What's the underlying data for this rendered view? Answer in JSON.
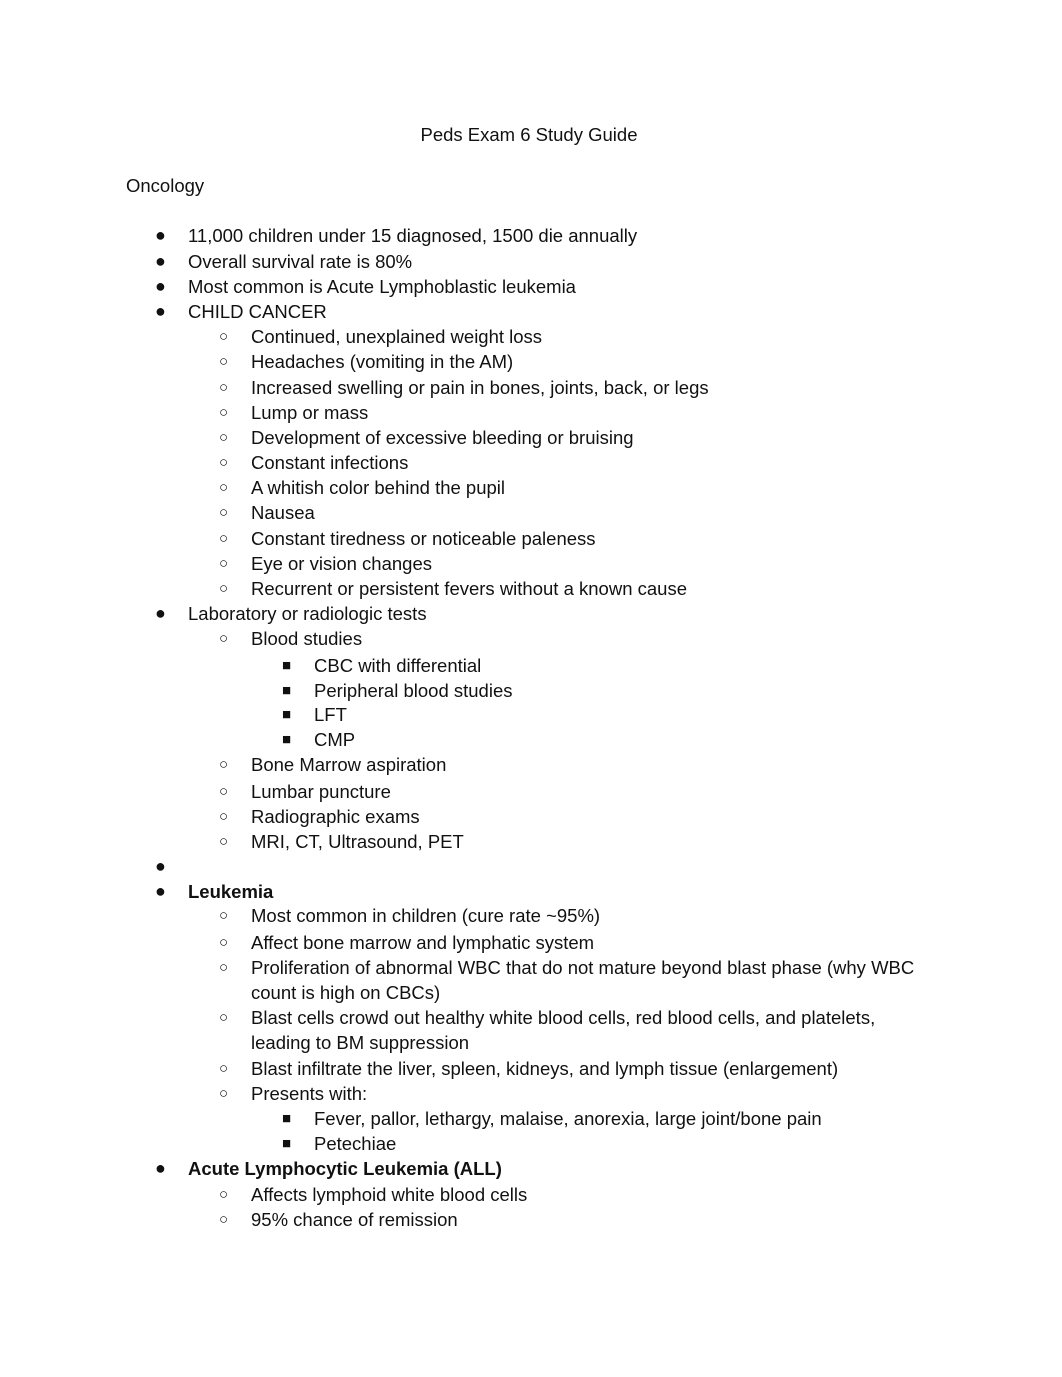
{
  "document": {
    "title": "Peds Exam 6 Study Guide",
    "section_heading": "Oncology",
    "bullet_glyphs": {
      "level1": "●",
      "level2": "○",
      "level3": "■"
    },
    "items": {
      "stats1": "11,000 children under 15 diagnosed, 1500 die annually",
      "stats2": "Overall survival rate is 80%",
      "stats3": "Most common is Acute Lymphoblastic leukemia",
      "child_cancer": {
        "label": "CHILD CANCER",
        "signs": [
          "Continued, unexplained weight loss",
          "Headaches (vomiting in the AM)",
          "Increased swelling or pain in bones, joints, back, or legs",
          "Lump or mass",
          "Development of excessive bleeding or bruising",
          "Constant infections",
          "A whitish color behind the pupil",
          "Nausea",
          "Constant tiredness or noticeable paleness",
          "Eye or vision changes",
          "Recurrent or persistent fevers without a known cause"
        ]
      },
      "lab_tests": {
        "label": "Laboratory or radiologic tests",
        "blood_studies": {
          "label": "Blood studies",
          "items": [
            "CBC with differential",
            "Peripheral blood studies",
            "LFT",
            "CMP"
          ]
        },
        "others": [
          "Bone Marrow aspiration",
          "Lumbar puncture",
          "Radiographic exams",
          "MRI, CT, Ultrasound, PET"
        ]
      },
      "empty_bullet": "",
      "leukemia": {
        "label": "Leukemia",
        "points": [
          "Most common in children (cure rate ~95%)",
          "Affect bone marrow and lymphatic system",
          "Proliferation of abnormal WBC that do not mature beyond blast phase (why WBC",
          "count is high on CBCs)",
          "Blast cells crowd out healthy white blood cells, red blood cells, and platelets,",
          "leading to BM suppression",
          "Blast infiltrate the liver, spleen, kidneys, and lymph tissue (enlargement)"
        ],
        "presents_with": {
          "label": "Presents with:",
          "items": [
            "Fever, pallor, lethargy, malaise, anorexia, large joint/bone pain",
            "Petechiae"
          ]
        }
      },
      "all": {
        "label": "Acute Lymphocytic Leukemia (ALL)",
        "points": [
          "Affects lymphoid white blood cells",
          "95% chance of remission"
        ]
      }
    }
  }
}
